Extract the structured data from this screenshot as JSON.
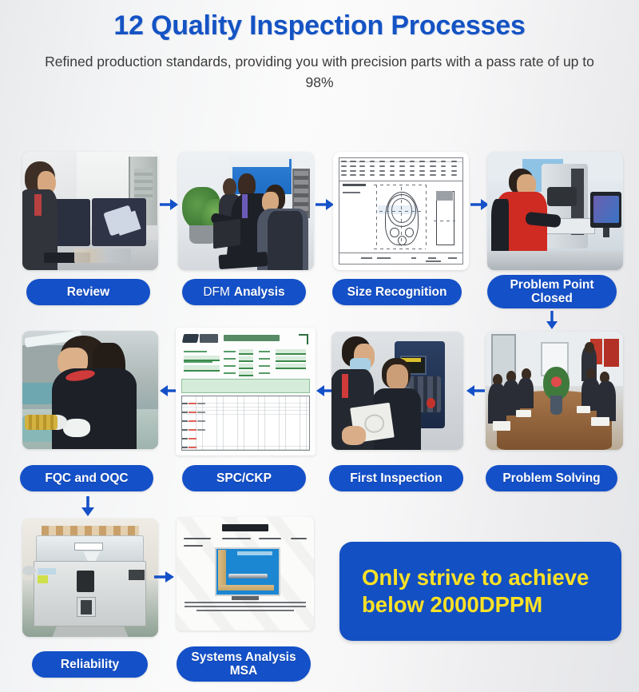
{
  "header": {
    "title": "12 Quality Inspection Processes",
    "subtitle": "Refined production standards, providing you with precision parts with a pass rate of up to 98%"
  },
  "colors": {
    "title_blue": "#1453c4",
    "pill_blue": "#1450c8",
    "cta_blue": "#1350c3",
    "cta_yellow": "#ffe225",
    "arrow_blue": "#1450c8",
    "background": "#f2f3f4"
  },
  "steps": [
    {
      "id": "review",
      "label": "Review",
      "row": 1,
      "col": 1
    },
    {
      "id": "dfm-analysis",
      "label": "DFM Analysis",
      "row": 1,
      "col": 2
    },
    {
      "id": "size-recognition",
      "label": "Size Recognition",
      "row": 1,
      "col": 3
    },
    {
      "id": "problem-point-closed",
      "label": "Problem Point\nClosed",
      "row": 1,
      "col": 4
    },
    {
      "id": "fqc-and-oqc",
      "label": "FQC and OQC",
      "row": 2,
      "col": 1
    },
    {
      "id": "spc-ckp",
      "label": "SPC/CKP",
      "row": 2,
      "col": 2
    },
    {
      "id": "first-inspection",
      "label": "First Inspection",
      "row": 2,
      "col": 3
    },
    {
      "id": "problem-solving",
      "label": "Problem Solving",
      "row": 2,
      "col": 4
    },
    {
      "id": "reliability",
      "label": "Reliability",
      "row": 3,
      "col": 1
    },
    {
      "id": "systems-analysis-msa",
      "label": "Systems Analysis\nMSA",
      "row": 3,
      "col": 2
    }
  ],
  "labels": {
    "review": "Review",
    "dfm_part1": "DFM",
    "dfm_part2": "Analysis",
    "size_recognition": "Size Recognition",
    "problem_point_line1": "Problem Point",
    "problem_point_line2": "Closed",
    "fqc_oqc": "FQC and OQC",
    "spc_ckp": "SPC/CKP",
    "first_inspection": "First Inspection",
    "problem_solving": "Problem Solving",
    "reliability": "Reliability",
    "msa_line1": "Systems Analysis",
    "msa_line2": "MSA"
  },
  "cta": {
    "line1": "Only strive to achieve",
    "line2": "below 2000DPPM"
  },
  "embedded_text": {
    "drawing_note": "3孔座",
    "drawing_footer": "基本尺寸  Dimensions",
    "spc_title": "CAPABILITY STUDY 制程能力分析",
    "report_title": "Test Report"
  },
  "arrows": [
    {
      "id": "review-to-dfm",
      "direction": "right"
    },
    {
      "id": "dfm-to-size",
      "direction": "right"
    },
    {
      "id": "size-to-problem-point",
      "direction": "right"
    },
    {
      "id": "problem-point-down",
      "direction": "down"
    },
    {
      "id": "problem-solving-to-first",
      "direction": "left"
    },
    {
      "id": "first-to-spc",
      "direction": "left"
    },
    {
      "id": "spc-to-fqc",
      "direction": "left"
    },
    {
      "id": "fqc-down",
      "direction": "down"
    },
    {
      "id": "reliability-to-msa",
      "direction": "right"
    }
  ]
}
